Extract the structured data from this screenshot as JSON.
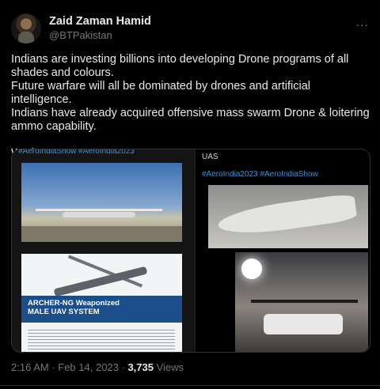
{
  "author": {
    "name": "Zaid Zaman Hamid",
    "handle": "@BTPakistan"
  },
  "more_icon": "...",
  "tweet": {
    "text": "Indians are investing billions into developing Drone programs of all shades and colours.\nFuture warfare will all be dominated by drones and artificial intelligence.\nIndians have already acquired offensive mass swarm Drone & loitering ammo capability.\n\nWe better gear up!"
  },
  "media": {
    "left_hashtags": "#AeroIndiaShow #AeroIndia2023",
    "archer_title": "ARCHER-NG Weaponized\nMALE UAV SYSTEM",
    "right_caption": "UAS",
    "right_hashtags": "#AeroIndia2023 #AeroIndiaShow"
  },
  "meta": {
    "time": "2:16 AM",
    "separator": " · ",
    "date": "Feb 14, 2023",
    "views_count": "3,735",
    "views_label": " Views"
  }
}
